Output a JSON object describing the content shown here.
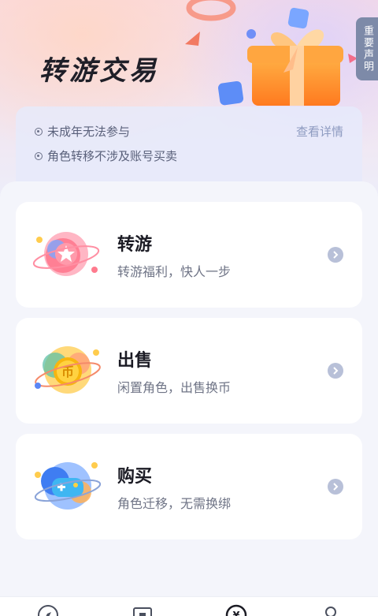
{
  "header": {
    "title": "转游交易",
    "notice_tab": "重要声明"
  },
  "tips": {
    "items": [
      "未成年无法参与",
      "角色转移不涉及账号买卖"
    ],
    "details_link": "查看详情"
  },
  "cards": [
    {
      "title": "转游",
      "subtitle": "转游福利，快人一步",
      "icon": "star-planet-icon"
    },
    {
      "title": "出售",
      "subtitle": "闲置角色，出售换币",
      "icon": "coin-planet-icon"
    },
    {
      "title": "购买",
      "subtitle": "角色迁移，无需换绑",
      "icon": "gamepad-planet-icon"
    }
  ],
  "tabbar": {
    "icons": [
      "compass-icon",
      "store-icon",
      "exchange-icon",
      "profile-icon"
    ]
  },
  "colors": {
    "accent": "#8d9ac0",
    "notice_tab_bg": "#7d8aa8",
    "title_text": "#1b1b24"
  }
}
